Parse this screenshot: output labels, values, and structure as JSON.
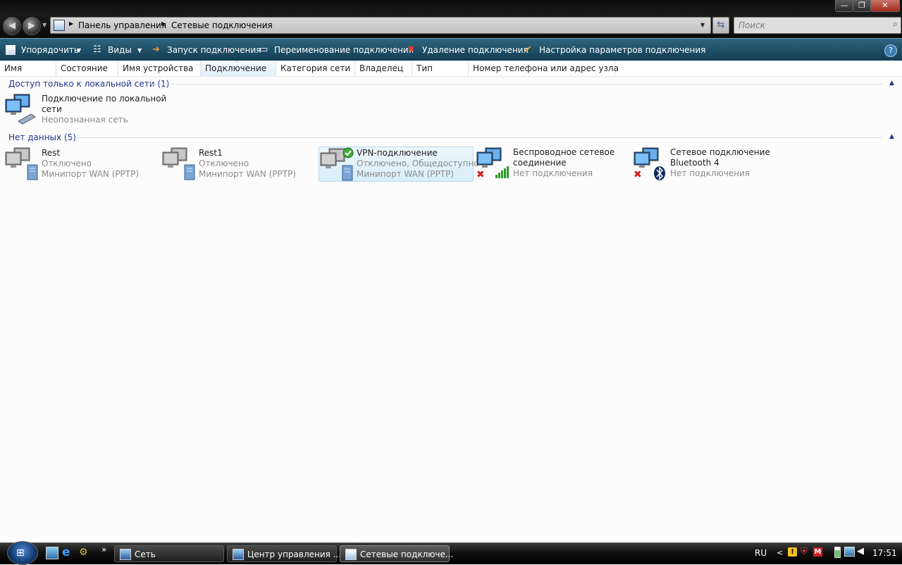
{
  "window": {
    "breadcrumb": [
      "Панель управления",
      "Сетевые подключения"
    ],
    "search_placeholder": "Поиск",
    "controls": {
      "minimize": "—",
      "maximize": "❐",
      "close": "✕"
    }
  },
  "toolbar": {
    "organize": "Упорядочить",
    "views": "Виды",
    "start_connection": "Запуск подключения",
    "rename_connection": "Переименование подключения",
    "delete_connection": "Удаление подключения",
    "connection_settings": "Настройка параметров подключения",
    "help": "?"
  },
  "columns": [
    "Имя",
    "Состояние",
    "Имя устройства",
    "Подключение",
    "Категория сети",
    "Владелец",
    "Тип",
    "Номер телефона или адрес узла"
  ],
  "groups": [
    {
      "title": "Доступ только к локальной сети (1)",
      "items": [
        {
          "name_line1": "Подключение по локальной",
          "name_line2": "сети",
          "status": "Неопознанная сеть",
          "device": ""
        }
      ]
    },
    {
      "title": "Нет данных (5)",
      "items": [
        {
          "name_line1": "Rest",
          "name_line2": "",
          "status": "Отключено",
          "device": "Минипорт WAN (PPTP)"
        },
        {
          "name_line1": "Rest1",
          "name_line2": "",
          "status": "Отключено",
          "device": "Минипорт WAN (PPTP)"
        },
        {
          "name_line1": "VPN-подключение",
          "name_line2": "",
          "status": "Отключено, Общедоступно",
          "device": "Минипорт WAN (PPTP)"
        },
        {
          "name_line1": "Беспроводное сетевое",
          "name_line2": "соединение",
          "status": "Нет подключения",
          "device": ""
        },
        {
          "name_line1": "Сетевое подключение",
          "name_line2": "Bluetooth 4",
          "status": "Нет подключения",
          "device": ""
        }
      ]
    }
  ],
  "taskbar": {
    "buttons": [
      "Сеть",
      "Центр управления ...",
      "Сетевые подключе..."
    ],
    "language": "RU",
    "clock": "17:51",
    "show_more": "»",
    "tray_expand": "<"
  },
  "colors": {
    "toolbar": "#1f4f67",
    "group_header": "#1e3287",
    "selection": "#d9eefb"
  }
}
